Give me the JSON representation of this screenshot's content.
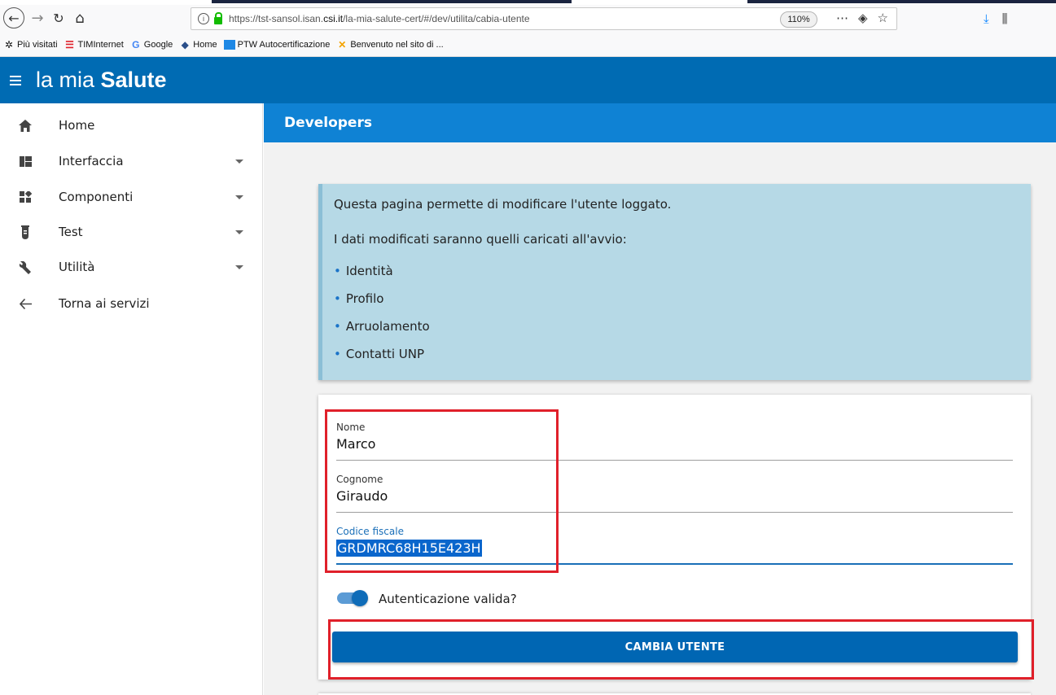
{
  "browser": {
    "url_prefix": "https://tst-sansol.isan.",
    "url_domain": "csi.it",
    "url_path": "/la-mia-salute-cert/#/dev/utilita/cabia-utente",
    "zoom": "110%",
    "bookmarks": [
      {
        "label": "Più visitati",
        "icon": "gear-icon"
      },
      {
        "label": "TIMInternet",
        "icon": "tim-icon"
      },
      {
        "label": "Google",
        "icon": "google-icon"
      },
      {
        "label": "Home",
        "icon": "home-bookmark-icon"
      },
      {
        "label": "PTW Autocertificazione",
        "icon": "ptw-icon"
      },
      {
        "label": "Benvenuto nel sito di ...",
        "icon": "joomla-icon"
      }
    ]
  },
  "app": {
    "brand_light": "la mia ",
    "brand_bold": "Salute",
    "accent": "#006bb3"
  },
  "sidebar": {
    "items": [
      {
        "label": "Home",
        "icon": "home-icon",
        "expandable": false
      },
      {
        "label": "Interfaccia",
        "icon": "dashboard-icon",
        "expandable": true
      },
      {
        "label": "Componenti",
        "icon": "widgets-icon",
        "expandable": true
      },
      {
        "label": "Test",
        "icon": "flask-icon",
        "expandable": true
      },
      {
        "label": "Utilità",
        "icon": "wrench-icon",
        "expandable": true
      },
      {
        "label": "Torna ai servizi",
        "icon": "arrow-left-icon",
        "expandable": false
      }
    ]
  },
  "page": {
    "title": "Developers",
    "info": {
      "line1": "Questa pagina permette di modificare l'utente loggato.",
      "line2": "I dati modificati saranno quelli caricati all'avvio:",
      "bullets": [
        "Identità",
        "Profilo",
        "Arruolamento",
        "Contatti UNP"
      ]
    },
    "form": {
      "nome_label": "Nome",
      "nome_value": "Marco",
      "cognome_label": "Cognome",
      "cognome_value": "Giraudo",
      "cf_label": "Codice fiscale",
      "cf_value": "GRDMRC68H15E423H",
      "toggle_label": "Autenticazione valida?",
      "toggle_on": true,
      "submit_label": "CAMBIA UTENTE"
    }
  }
}
